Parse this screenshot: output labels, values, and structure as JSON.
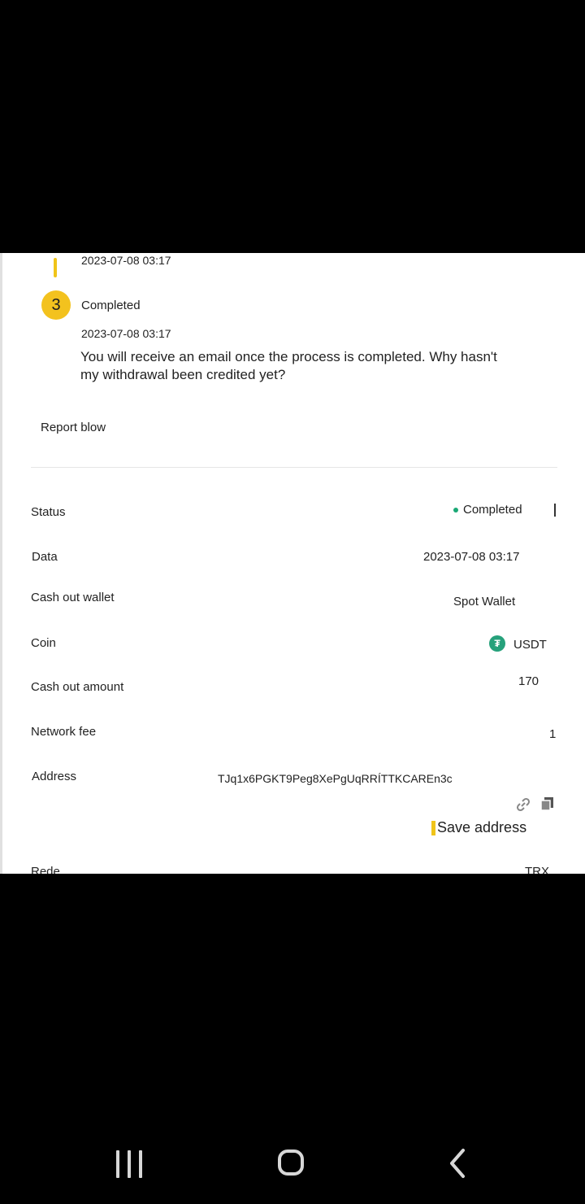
{
  "timeline": {
    "prev_time": "2023-07-08 03:17",
    "step_number": "3",
    "step_label": "Completed",
    "step_time": "2023-07-08 03:17",
    "message": "You will receive an email once the process is completed. Why hasn't my withdrawal been credited yet?"
  },
  "report_label": "Report blow",
  "details": {
    "status_label": "Status",
    "status_value": "Completed",
    "date_label": "Data",
    "date_value": "2023-07-08  03:17",
    "wallet_label": "Cash out wallet",
    "wallet_value": "Spot Wallet",
    "coin_label": "Coin",
    "coin_value": "USDT",
    "amount_label": "Cash out amount",
    "amount_value": "170",
    "fee_label": "Network fee",
    "fee_value": "1",
    "address_label": "Address",
    "address_value": "TJq1x6PGKT9Peg8XePgUqRRÍTTKCAREn3c",
    "save_address_label": "Save address",
    "network_label": "Rede",
    "network_value": "TRX"
  },
  "icons": {
    "coin_icon": "tether-icon",
    "link_icon": "link-icon",
    "copy_icon": "copy-icon"
  },
  "colors": {
    "accent": "#f3c21e",
    "status_green": "#1aa875",
    "tether_green": "#26a17b"
  }
}
